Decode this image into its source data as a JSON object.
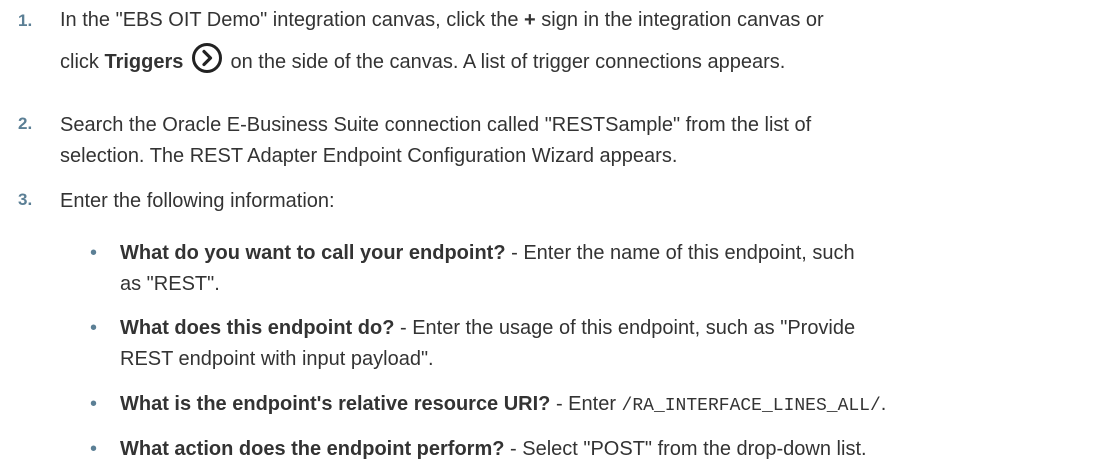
{
  "steps": [
    {
      "num": "1.",
      "line1_pre": "In the \"EBS OIT Demo\" integration canvas, click the ",
      "plus": "+",
      "line1_post": " sign in the integration canvas or",
      "line2_pre": "click ",
      "triggers": "Triggers",
      "icon": "chevron-circle-right-icon",
      "line2_post": " on the side of the canvas. A list of trigger connections appears."
    },
    {
      "num": "2.",
      "line1": "Search the Oracle E-Business Suite connection called \"RESTSample\" from the list of",
      "line2": "selection. The REST Adapter Endpoint Configuration Wizard appears."
    },
    {
      "num": "3.",
      "text": "Enter the following information:"
    }
  ],
  "bullets": [
    {
      "marker": "•",
      "bold": "What do you want to call your endpoint?",
      "line1": " - Enter the name of this endpoint, such",
      "line2": "as \"REST\"."
    },
    {
      "marker": "•",
      "bold": "What does this endpoint do?",
      "line1": " - Enter the usage of this endpoint, such as \"Provide",
      "line2": "REST endpoint with input payload\"."
    },
    {
      "marker": "•",
      "bold": "What is the endpoint's relative resource URI?",
      "pre": " - Enter ",
      "code": "/RA_INTERFACE_LINES_ALL/",
      "post": "."
    },
    {
      "marker": "•",
      "bold": "What action does the endpoint perform?",
      "text": " - Select \"POST\" from the drop-down list."
    }
  ]
}
